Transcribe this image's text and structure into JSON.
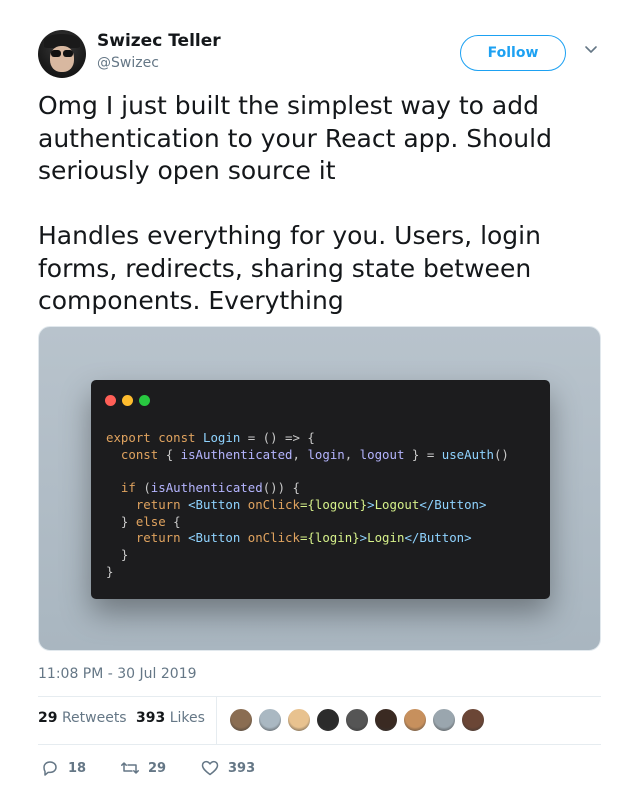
{
  "author": {
    "name": "Swizec Teller",
    "handle": "@Swizec"
  },
  "follow_label": "Follow",
  "tweet_text": "Omg I just built the simplest way to add authentication to your React app. Should seriously open source it\n\nHandles everything for you. Users, login forms, redirects, sharing state between components. Everything",
  "code": {
    "line1_kw": "export const ",
    "line1_fn": "Login",
    "line1_rest": " = () => {",
    "line2_kw": "  const ",
    "line2_b1": "{ ",
    "line2_v1": "isAuthenticated",
    "line2_c1": ", ",
    "line2_v2": "login",
    "line2_c2": ", ",
    "line2_v3": "logout",
    "line2_b2": " } = ",
    "line2_fn": "useAuth",
    "line2_end": "()",
    "line3": "",
    "line4_kw": "  if ",
    "line4_p1": "(",
    "line4_fn": "isAuthenticated",
    "line4_end": "()) {",
    "line5_kw": "    return ",
    "line5_t1": "<Button ",
    "line5_attr": "onClick",
    "line5_val": "={logout}",
    "line5_t2": ">",
    "line5_txt": "Logout",
    "line5_t3": "</Button>",
    "line6_a": "  } ",
    "line6_kw": "else",
    "line6_b": " {",
    "line7_kw": "    return ",
    "line7_t1": "<Button ",
    "line7_attr": "onClick",
    "line7_val": "={login}",
    "line7_t2": ">",
    "line7_txt": "Login",
    "line7_t3": "</Button>",
    "line8": "  }",
    "line9": "}"
  },
  "timestamp": "11:08 PM - 30 Jul 2019",
  "stats": {
    "retweets_count": "29",
    "retweets_label": "Retweets",
    "likes_count": "393",
    "likes_label": "Likes"
  },
  "likers_colors": [
    "#8a6d52",
    "#aab8c2",
    "#e8c28f",
    "#2b2b2b",
    "#555555",
    "#3a2a22",
    "#c7905d",
    "#9aa6ae",
    "#6b4636"
  ],
  "actions": {
    "replies": "18",
    "retweets": "29",
    "likes": "393"
  },
  "colors": {
    "accent": "#1da1f2",
    "muted": "#657786",
    "text": "#14171a"
  },
  "icons": {
    "reply": "reply-icon",
    "retweet": "retweet-icon",
    "like": "heart-icon",
    "caret": "chevron-down-icon"
  }
}
